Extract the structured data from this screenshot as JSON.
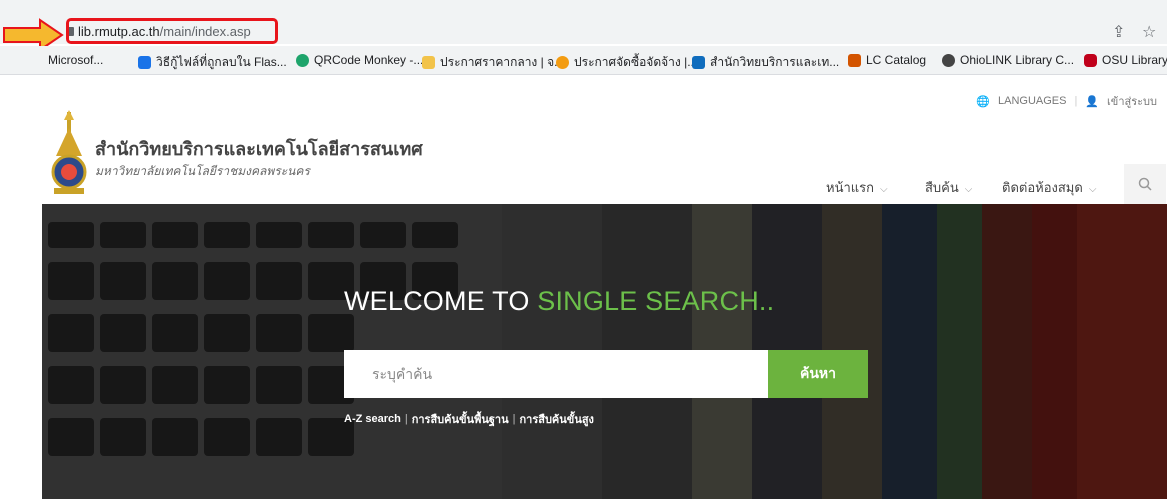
{
  "browser": {
    "url_host": "lib.rmutp.ac.th",
    "url_path": "/main/index.asp",
    "bookmarks": [
      {
        "label": "Microsof...",
        "icon": "none"
      },
      {
        "label": "วิธีกู้ไฟล์ที่ถูกลบใน Flas...",
        "icon": "web-icon"
      },
      {
        "label": "QRCode Monkey -...",
        "icon": "qrcode-monkey-icon"
      },
      {
        "label": "ประกาศราคากลาง | จ...",
        "icon": "doc-icon"
      },
      {
        "label": "ประกาศจัดซื้อจัดจ้าง |...",
        "icon": "coin-icon"
      },
      {
        "label": "สำนักวิทยบริการและเท...",
        "icon": "outlook-icon"
      },
      {
        "label": "LC Catalog",
        "icon": "loc-icon"
      },
      {
        "label": "OhioLINK Library C...",
        "icon": "globe-icon"
      },
      {
        "label": "OSU Library",
        "icon": "osu-icon"
      }
    ]
  },
  "header": {
    "languages": "LANGUAGES",
    "login": "เข้าสู่ระบบ",
    "title": "สำนักวิทยบริการและเทคโนโลยีสารสนเทศ",
    "subtitle": "มหาวิทยาลัยเทคโนโลยีราชมงคลพระนคร",
    "nav": [
      {
        "label": "หน้าแรก"
      },
      {
        "label": "สืบค้น"
      },
      {
        "label": "ติดต่อห้องสมุด"
      }
    ]
  },
  "hero": {
    "title_main": "WELCOME TO ",
    "title_accent": "SINGLE SEARCH..",
    "accent_color": "#6cc04a",
    "search_placeholder": "ระบุคำค้น",
    "search_button": "ค้นหา",
    "links": [
      "A-Z search",
      "การสืบค้นขั้นพื้นฐาน",
      "การสืบค้นขั้นสูง"
    ]
  }
}
